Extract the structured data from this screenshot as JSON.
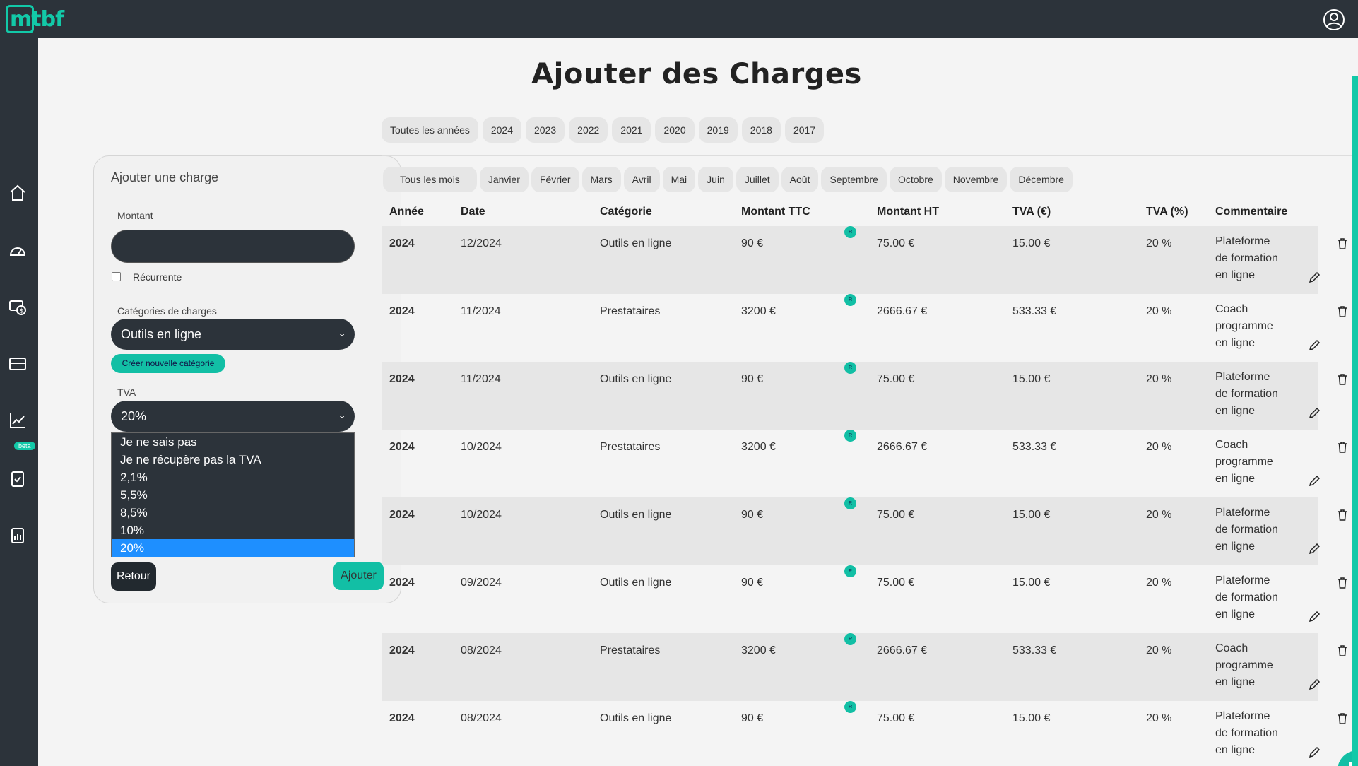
{
  "brand": {
    "logo_text": "mtbf",
    "accent": "#12c9a8"
  },
  "page": {
    "title": "Ajouter des Charges"
  },
  "sidebar": {
    "items": [
      {
        "icon": "home-icon"
      },
      {
        "icon": "dashboard-icon"
      },
      {
        "icon": "money-icon"
      },
      {
        "icon": "wallet-icon"
      },
      {
        "icon": "chart-icon",
        "badge": "beta"
      },
      {
        "icon": "clipboard-check-icon"
      },
      {
        "icon": "report-icon"
      }
    ]
  },
  "form": {
    "title": "Ajouter une charge",
    "amount_label": "Montant",
    "amount_value": "",
    "recurring_label": "Récurrente",
    "category_label": "Catégories de charges",
    "category_value": "Outils en ligne",
    "new_category_label": "Créer nouvelle catégorie",
    "tva_label": "TVA",
    "tva_value": "20%",
    "tva_options": [
      "Je ne sais pas",
      "Je ne récupère pas la TVA",
      "2,1%",
      "5,5%",
      "8,5%",
      "10%",
      "20%"
    ],
    "back_label": "Retour",
    "add_label": "Ajouter"
  },
  "filters": {
    "years": [
      "Toutes les années",
      "2024",
      "2023",
      "2022",
      "2021",
      "2020",
      "2019",
      "2018",
      "2017"
    ],
    "months": [
      "Tous les mois",
      "Janvier",
      "Février",
      "Mars",
      "Avril",
      "Mai",
      "Juin",
      "Juillet",
      "Août",
      "Septembre",
      "Octobre",
      "Novembre",
      "Décembre"
    ]
  },
  "table": {
    "headers": [
      "Année",
      "Date",
      "Catégorie",
      "Montant TTC",
      "Montant HT",
      "TVA (€)",
      "TVA (%)",
      "Commentaire"
    ],
    "recurring_badge": "R",
    "rows": [
      {
        "annee": "2024",
        "date": "12/2024",
        "categorie": "Outils en ligne",
        "ttc": "90 €",
        "ht": "75.00 €",
        "tva": "15.00 €",
        "tvap": "20 %",
        "commentaire": [
          "Plateforme",
          "de formation",
          "en ligne"
        ]
      },
      {
        "annee": "2024",
        "date": "11/2024",
        "categorie": "Prestataires",
        "ttc": "3200 €",
        "ht": "2666.67 €",
        "tva": "533.33 €",
        "tvap": "20 %",
        "commentaire": [
          "Coach",
          "programme",
          "en ligne"
        ]
      },
      {
        "annee": "2024",
        "date": "11/2024",
        "categorie": "Outils en ligne",
        "ttc": "90 €",
        "ht": "75.00 €",
        "tva": "15.00 €",
        "tvap": "20 %",
        "commentaire": [
          "Plateforme",
          "de formation",
          "en ligne"
        ]
      },
      {
        "annee": "2024",
        "date": "10/2024",
        "categorie": "Prestataires",
        "ttc": "3200 €",
        "ht": "2666.67 €",
        "tva": "533.33 €",
        "tvap": "20 %",
        "commentaire": [
          "Coach",
          "programme",
          "en ligne"
        ]
      },
      {
        "annee": "2024",
        "date": "10/2024",
        "categorie": "Outils en ligne",
        "ttc": "90 €",
        "ht": "75.00 €",
        "tva": "15.00 €",
        "tvap": "20 %",
        "commentaire": [
          "Plateforme",
          "de formation",
          "en ligne"
        ]
      },
      {
        "annee": "2024",
        "date": "09/2024",
        "categorie": "Outils en ligne",
        "ttc": "90 €",
        "ht": "75.00 €",
        "tva": "15.00 €",
        "tvap": "20 %",
        "commentaire": [
          "Plateforme",
          "de formation",
          "en ligne"
        ]
      },
      {
        "annee": "2024",
        "date": "08/2024",
        "categorie": "Prestataires",
        "ttc": "3200 €",
        "ht": "2666.67 €",
        "tva": "533.33 €",
        "tvap": "20 %",
        "commentaire": [
          "Coach",
          "programme",
          "en ligne"
        ]
      },
      {
        "annee": "2024",
        "date": "08/2024",
        "categorie": "Outils en ligne",
        "ttc": "90 €",
        "ht": "75.00 €",
        "tva": "15.00 €",
        "tvap": "20 %",
        "commentaire": [
          "Plateforme",
          "de formation",
          "en ligne"
        ]
      }
    ]
  }
}
